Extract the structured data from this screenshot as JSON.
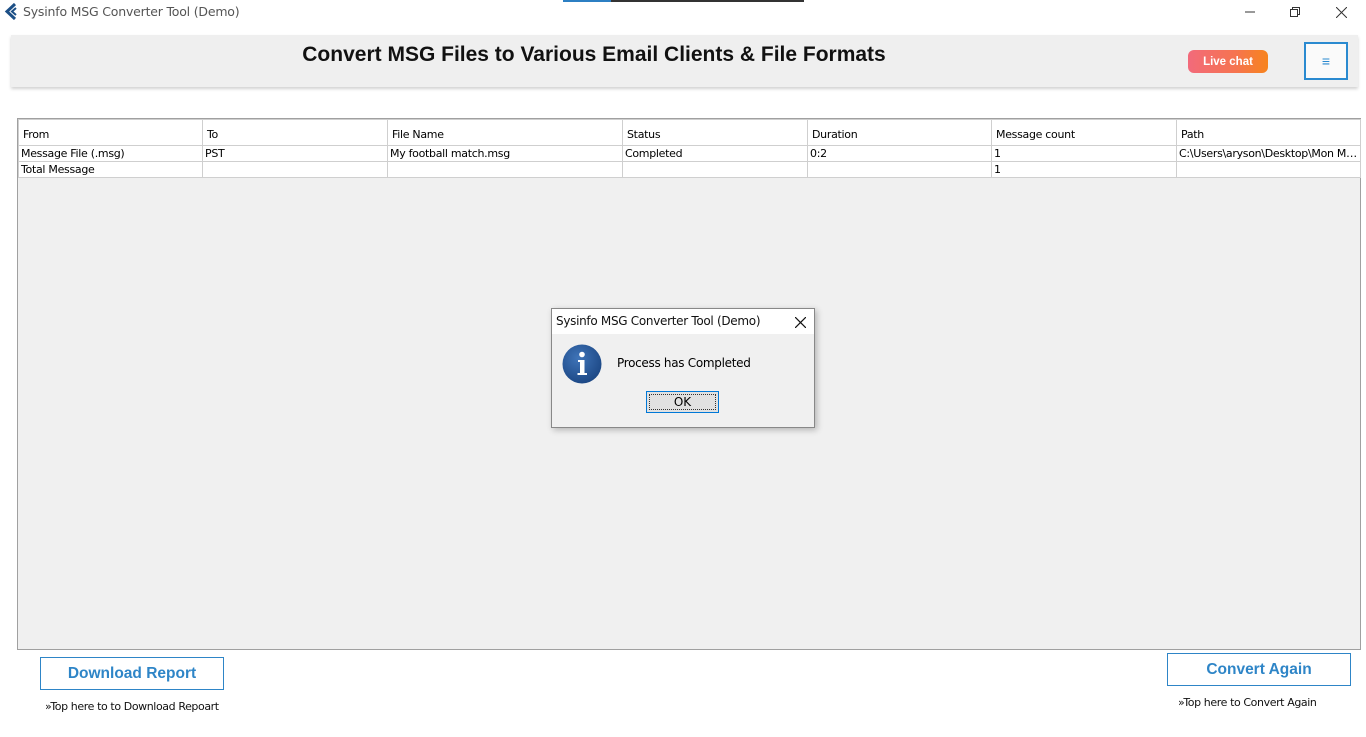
{
  "window": {
    "title": "Sysinfo MSG Converter Tool (Demo)"
  },
  "header": {
    "title": "Convert MSG Files to Various Email Clients & File Formats",
    "live_chat_label": "Live chat",
    "menu_icon": "hamburger-menu-icon"
  },
  "grid": {
    "columns": [
      "From",
      "To",
      "File Name",
      "Status",
      "Duration",
      "Message count",
      "Path"
    ],
    "rows": [
      [
        "Message File (.msg)",
        "PST",
        "My football match.msg",
        "Completed",
        "0:2",
        "1",
        "C:\\Users\\aryson\\Desktop\\Mon May..."
      ],
      [
        "Total Message",
        "",
        "",
        "",
        "",
        "1",
        ""
      ]
    ]
  },
  "dialog": {
    "title": "Sysinfo MSG Converter Tool (Demo)",
    "message": "Process has Completed",
    "ok_label": "OK",
    "icon": "info-icon"
  },
  "footer": {
    "download_label": "Download Report",
    "download_hint": "»Top here to to Download Repoart",
    "convert_label": "Convert Again",
    "convert_hint": "»Top here to Convert Again"
  },
  "colors": {
    "accent": "#2e85c7",
    "live_chat_start": "#f26a7b",
    "live_chat_end": "#f7841d",
    "info_icon": "#1f4e8c"
  }
}
